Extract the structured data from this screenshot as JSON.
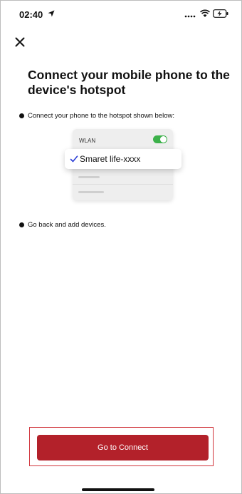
{
  "status_bar": {
    "time": "02:40",
    "icons": [
      "location-icon",
      "signal-icon",
      "wifi-icon",
      "battery-icon"
    ]
  },
  "nav": {
    "close_icon": "close-icon"
  },
  "title": "Connect your mobile phone to the device's hotspot",
  "steps": [
    "Connect your phone to the hotspot shown below:",
    "Go back and add devices."
  ],
  "illustration": {
    "wlan_label": "WLAN",
    "wlan_enabled": true,
    "network_name": "Smaret life-xxxx",
    "network_selected": true
  },
  "actions": {
    "connect_label": "Go to Connect"
  },
  "colors": {
    "primary": "#b3212a",
    "toggle_on": "#3cb14a",
    "check": "#2c3fd6",
    "highlight_border": "#d0343b"
  }
}
